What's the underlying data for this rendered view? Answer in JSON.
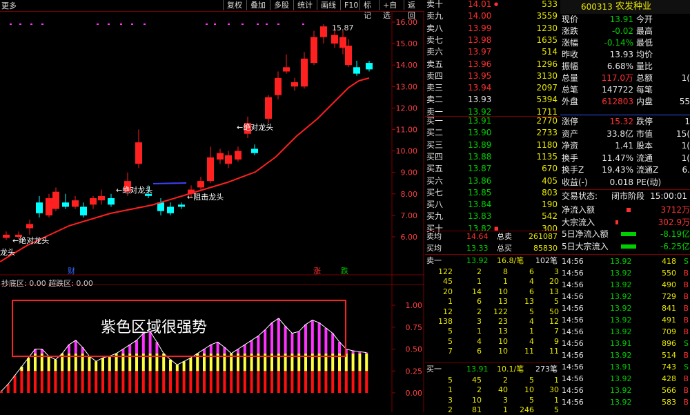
{
  "toolbar": {
    "more": "更多",
    "buttons": [
      "复权",
      "叠加",
      "多股",
      "统计",
      "画线",
      "F10",
      "标记",
      "+自选",
      "返回"
    ]
  },
  "stock": {
    "code": "600313",
    "name": "农发种业"
  },
  "price_axis": [
    "16.00",
    "15.00",
    "14.00",
    "13.00",
    "12.00",
    "11.00",
    "10.00",
    "9.00",
    "8.00",
    "7.00",
    "6.00"
  ],
  "indicator_axis": [
    "1.00",
    "0.75",
    "0.50",
    "0.25",
    "0.00"
  ],
  "annotations": {
    "high": "15.87",
    "labels": [
      "←绝对龙头",
      "←绝对龙头",
      "←阻击龙头",
      "←绝对龙头",
      "龙头"
    ],
    "cai": "财",
    "zhang": "涨",
    "die": "跌",
    "indicator_title": "抄底区: 0.00  超跌区: 0.00",
    "box_text": "紫色区域很强势"
  },
  "asks": [
    {
      "label": "卖十",
      "price": "14.01",
      "vol": "533",
      "mark": "●"
    },
    {
      "label": "卖九",
      "price": "14.00",
      "vol": "3559"
    },
    {
      "label": "卖八",
      "price": "13.99",
      "vol": "1230"
    },
    {
      "label": "卖七",
      "price": "13.98",
      "vol": "1635"
    },
    {
      "label": "卖六",
      "price": "13.97",
      "vol": "514"
    },
    {
      "label": "卖五",
      "price": "13.96",
      "vol": "1296"
    },
    {
      "label": "卖四",
      "price": "13.95",
      "vol": "3130"
    },
    {
      "label": "卖三",
      "price": "13.94",
      "vol": "2097"
    },
    {
      "label": "卖二",
      "price": "13.93",
      "vol": "5394"
    },
    {
      "label": "卖一",
      "price": "13.92",
      "vol": "1711"
    }
  ],
  "bids": [
    {
      "label": "买一",
      "price": "13.91",
      "vol": "2770"
    },
    {
      "label": "买二",
      "price": "13.90",
      "vol": "2733"
    },
    {
      "label": "买三",
      "price": "13.89",
      "vol": "1180"
    },
    {
      "label": "买四",
      "price": "13.88",
      "vol": "1135"
    },
    {
      "label": "买五",
      "price": "13.87",
      "vol": "670"
    },
    {
      "label": "买六",
      "price": "13.86",
      "vol": "405"
    },
    {
      "label": "买七",
      "price": "13.85",
      "vol": "803"
    },
    {
      "label": "买八",
      "price": "13.84",
      "vol": "190"
    },
    {
      "label": "买九",
      "price": "13.83",
      "vol": "542"
    },
    {
      "label": "买十",
      "price": "13.82",
      "vol": "300",
      "mark": "■"
    }
  ],
  "summary": [
    {
      "l1": "卖均",
      "v1": "14.64",
      "l2": "总卖",
      "v2": "261087"
    },
    {
      "l1": "买均",
      "v1": "13.33",
      "l2": "总买",
      "v2": "85830"
    }
  ],
  "queue_sell": {
    "label": "卖一",
    "price": "13.92",
    "count": "16.8/笔",
    "total": "102笔",
    "rows": [
      [
        "122",
        "2",
        "8",
        "6",
        "3"
      ],
      [
        "45",
        "1",
        "1",
        "4",
        "20"
      ],
      [
        "20",
        "14",
        "10",
        "6",
        "13"
      ],
      [
        "1",
        "6",
        "13",
        "13",
        "5"
      ],
      [
        "12",
        "2",
        "122",
        "5",
        "50"
      ],
      [
        "138",
        "3",
        "23",
        "4",
        "12"
      ],
      [
        "5",
        "1",
        "13",
        "1",
        "7"
      ],
      [
        "5",
        "4",
        "10",
        "4",
        "9"
      ],
      [
        "7",
        "6",
        "10",
        "11",
        "11"
      ]
    ]
  },
  "queue_buy": {
    "label": "买一",
    "price": "13.91",
    "count": "10.1/笔",
    "total": "273笔",
    "rows": [
      [
        "5",
        "45",
        "2",
        "5",
        "1"
      ],
      [
        "1",
        "2",
        "40",
        "10",
        "30"
      ],
      [
        "3",
        "10",
        "3",
        "5",
        "1"
      ],
      [
        "2",
        "81",
        "1",
        "246",
        "5"
      ]
    ]
  },
  "info": [
    {
      "a": "现价",
      "b": "13.91",
      "c": "今开",
      "d": ""
    },
    {
      "a": "涨跌",
      "b": "-0.02",
      "c": "最高",
      "d": ""
    },
    {
      "a": "涨幅",
      "b": "-0.14%",
      "c": "最低",
      "d": ""
    },
    {
      "a": "昨收",
      "b": "13.93",
      "c": "均价",
      "d": ""
    },
    {
      "a": "振幅",
      "b": "6.68%",
      "c": "量比",
      "d": ""
    },
    {
      "a": "总量",
      "b": "117.0万",
      "c": "总额",
      "d": "1("
    },
    {
      "a": "总笔",
      "b": "147722",
      "c": "每笔",
      "d": ""
    },
    {
      "a": "外盘",
      "b": "612803",
      "c": "内盘",
      "d": "55"
    },
    {
      "a": "涨停",
      "b": "15.32",
      "c": "跌停",
      "d": "1"
    },
    {
      "a": "资产",
      "b": "33.8亿",
      "c": "市值",
      "d": "15("
    },
    {
      "a": "净资",
      "b": "1.41",
      "c": "股本",
      "d": "1("
    },
    {
      "a": "换手",
      "b": "11.47%",
      "c": "流通",
      "d": "1("
    },
    {
      "a": "换手Z",
      "b": "19.43%",
      "c": "流通Z",
      "d": "6."
    },
    {
      "a": "收益(-)",
      "b": "0.018",
      "c": "PE(动)",
      "d": ""
    }
  ],
  "trade_status": {
    "label": "交易状态:",
    "value": "闭市阶段",
    "time": "15:00:01"
  },
  "flows": [
    {
      "label": "净流入额",
      "value": "3712万"
    },
    {
      "label": "大宗流入",
      "value": "302.9万"
    },
    {
      "label": "5日净流入额",
      "value": "-8.19亿"
    },
    {
      "label": "5日大宗流入",
      "value": "-6.25亿"
    }
  ],
  "ticks": [
    {
      "t": "14:56",
      "p": "13.92",
      "v": "418",
      "s": "S"
    },
    {
      "t": "14:56",
      "p": "13.92",
      "v": "550",
      "s": "B"
    },
    {
      "t": "14:56",
      "p": "13.92",
      "v": "490",
      "s": "B"
    },
    {
      "t": "14:56",
      "p": "13.92",
      "v": "729",
      "s": "B"
    },
    {
      "t": "14:56",
      "p": "13.92",
      "v": "841",
      "s": "B"
    },
    {
      "t": "14:56",
      "p": "13.92",
      "v": "491",
      "s": "B"
    },
    {
      "t": "14:56",
      "p": "13.92",
      "v": "709",
      "s": "B"
    },
    {
      "t": "14:56",
      "p": "13.91",
      "v": "896",
      "s": "S"
    },
    {
      "t": "14:56",
      "p": "13.92",
      "v": "514",
      "s": "B"
    },
    {
      "t": "14:56",
      "p": "13.91",
      "v": "743",
      "s": "S"
    },
    {
      "t": "14:56",
      "p": "13.92",
      "v": "428",
      "s": "B"
    },
    {
      "t": "14:56",
      "p": "13.92",
      "v": "566",
      "s": "B"
    },
    {
      "t": "14:56",
      "p": "13.92",
      "v": "583",
      "s": "B"
    }
  ],
  "colors": {
    "up": "#ff2020",
    "down": "#00ffff",
    "ma": "#ff2020",
    "purple": "#ff33ff",
    "yellow": "#ffff40"
  }
}
